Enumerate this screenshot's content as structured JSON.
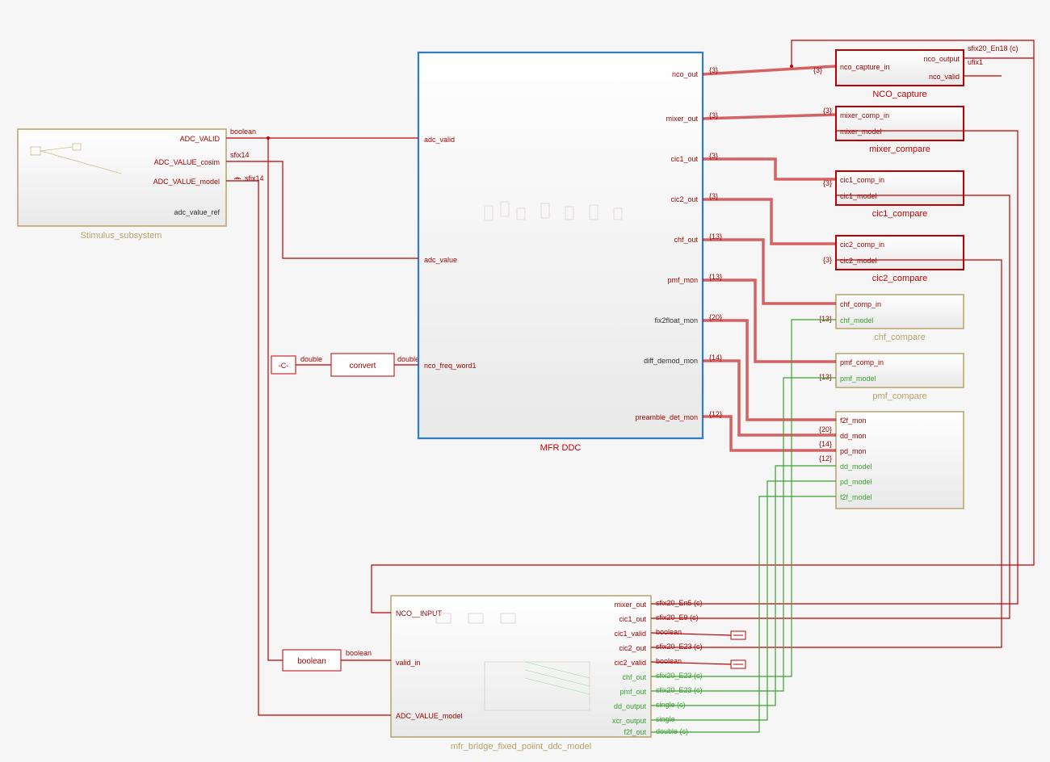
{
  "stimulus": {
    "title": "Stimulus_subsystem",
    "ports": {
      "adc_valid": "ADC_VALID",
      "adc_value_cosim": "ADC_VALUE_cosim",
      "adc_value_model": "ADC_VALUE_model",
      "adc_value_ref": "adc_value_ref"
    },
    "types": {
      "boolean": "boolean",
      "sfix14a": "sfix14",
      "sfix14b": "sfix14"
    }
  },
  "const_block": {
    "label": "-C-"
  },
  "convert_block": {
    "label": "convert",
    "in_type": "double",
    "out_type": "double"
  },
  "boolean_block": {
    "label": "boolean",
    "out_type": "boolean"
  },
  "mfr_ddc": {
    "title": "MFR DDC",
    "in_ports": {
      "adc_valid": "adc_valid",
      "adc_value": "adc_value",
      "nco_freq_word1": "nco_freq_word1"
    },
    "out_ports": {
      "nco_out": "nco_out",
      "mixer_out": "mixer_out",
      "cic1_out": "cic1_out",
      "cic2_out": "cic2_out",
      "chf_out": "chf_out",
      "pmf_mon": "pmf_mon",
      "fix2float_mon": "fix2float_mon",
      "diff_demod_mon": "diff_demod_mon",
      "preamble_det_mon": "preamble_det_mon"
    },
    "widths": {
      "nco": "{3}",
      "mixer": "{3}",
      "cic1": "{3}",
      "cic2": "{3}",
      "chf": "{13}",
      "pmf": "{13}",
      "f2f": "{20}",
      "dd": "{14}",
      "pd": "{12}"
    }
  },
  "nco_capture": {
    "title": "NCO_capture",
    "in": "nco_capture_in",
    "out1": "nco_output",
    "out2": "nco_valid",
    "types": {
      "t1": "sfix20_En18 (c)",
      "t2": "ufix1"
    }
  },
  "mixer_compare": {
    "title": "mixer_compare",
    "in1": "mixer_comp_in",
    "in2": "mixer_model",
    "w": "{3}"
  },
  "cic1_compare": {
    "title": "cic1_compare",
    "in1": "cic1_comp_in",
    "in2": "cic1_model",
    "w": "{3}"
  },
  "cic2_compare": {
    "title": "cic2_compare",
    "in1": "cic2_comp_in",
    "in2": "cic2_model",
    "w": "{3}"
  },
  "chf_compare": {
    "title": "chf_compare",
    "in1": "chf_comp_in",
    "in2": "chf_model",
    "w": "{13}"
  },
  "pmf_compare": {
    "title": "pmf_compare",
    "in1": "pmf_comp_in",
    "in2": "pmf_model",
    "w": "{13}"
  },
  "mon_block": {
    "ports": {
      "f2f_mon": "f2f_mon",
      "dd_mon": "dd_mon",
      "pd_mon": "pd_mon",
      "dd_model": "dd_model",
      "pd_model": "pd_model",
      "f2f_model": "f2f_model"
    },
    "widths": {
      "f2f": "{20}",
      "dd": "{14}",
      "pd": "{12}"
    }
  },
  "bridge": {
    "title": "mfr_bridge_fixed_poiint_ddc_model",
    "in_ports": {
      "nco_input": "NCO__INPUT",
      "valid_in": "valid_in",
      "adc_value_model": "ADC_VALUE_model"
    },
    "out_ports": {
      "mixer_out": "mixer_out",
      "cic1_out": "cic1_out",
      "cic1_valid": "cic1_valid",
      "cic2_out": "cic2_out",
      "cic2_valid": "cic2_valid",
      "chf_out": "chf_out",
      "pmf_out": "pmf_out",
      "dd_output": "dd_output",
      "xcr_output": "xcr_output",
      "f2f_out": "f2f_out"
    },
    "types": {
      "t1": "sfix20_En5 (c)",
      "t2": "sfix20_E9 (c)",
      "t3": "boolean",
      "t4": "sfix20_E23 (c)",
      "t5": "boolean",
      "t6": "sfix20_E23 (c)",
      "t7": "sfix20_E23 (c)",
      "t8": "single (c)",
      "t9": "single",
      "t10": "double (c)"
    }
  }
}
